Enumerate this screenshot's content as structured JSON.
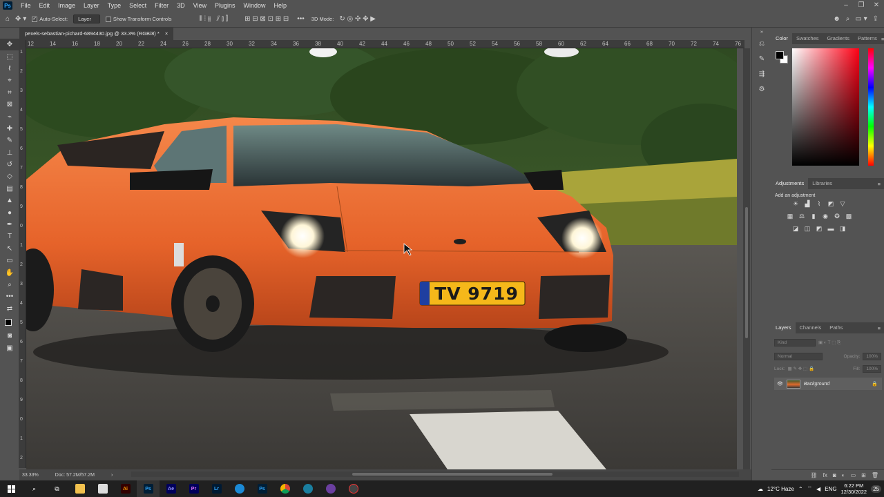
{
  "app": {
    "title": "Ps"
  },
  "menu": [
    "File",
    "Edit",
    "Image",
    "Layer",
    "Type",
    "Select",
    "Filter",
    "3D",
    "View",
    "Plugins",
    "Window",
    "Help"
  ],
  "options": {
    "auto_select_label": "Auto-Select:",
    "auto_select_target": "Layer",
    "transform_controls_label": "Show Transform Controls",
    "mode_3d_label": "3D Mode:"
  },
  "document": {
    "tab_title": "pexels-sebastian-pichard-6894430.jpg @ 33.3% (RGB/8) *",
    "close_glyph": "×",
    "zoom": "33.33%",
    "doc_size": "Doc: 57.2M/57.2M",
    "license_plate": "TV 9719"
  },
  "ruler_top": [
    "12",
    "14",
    "16",
    "18",
    "20",
    "22",
    "24",
    "26",
    "28",
    "30",
    "32",
    "34",
    "36",
    "38",
    "40",
    "42",
    "44",
    "46",
    "48",
    "50",
    "52",
    "54",
    "56",
    "58",
    "60",
    "62",
    "64",
    "66",
    "68",
    "70",
    "72",
    "74",
    "76"
  ],
  "ruler_left": [
    "1",
    "2",
    "3",
    "4",
    "5",
    "6",
    "7",
    "8",
    "9",
    "0",
    "1",
    "2",
    "3",
    "4",
    "5",
    "6",
    "7",
    "8",
    "9",
    "0",
    "1",
    "2"
  ],
  "color_panel": {
    "tabs": [
      "Color",
      "Swatches",
      "Gradients",
      "Patterns"
    ]
  },
  "adjustments_panel": {
    "tabs": [
      "Adjustments",
      "Libraries"
    ],
    "hint": "Add an adjustment"
  },
  "layers_panel": {
    "tabs": [
      "Layers",
      "Channels",
      "Paths"
    ],
    "filter_placeholder": "Kind",
    "blend_mode": "Normal",
    "opacity_label": "Opacity:",
    "opacity_value": "100%",
    "lock_label": "Lock:",
    "fill_label": "Fill:",
    "fill_value": "100%",
    "layers": [
      {
        "name": "Background"
      }
    ]
  },
  "taskbar": {
    "weather": "12°C Haze",
    "language": "ENG",
    "time": "6:22 PM",
    "date": "12/30/2022",
    "notification_count": "25"
  }
}
